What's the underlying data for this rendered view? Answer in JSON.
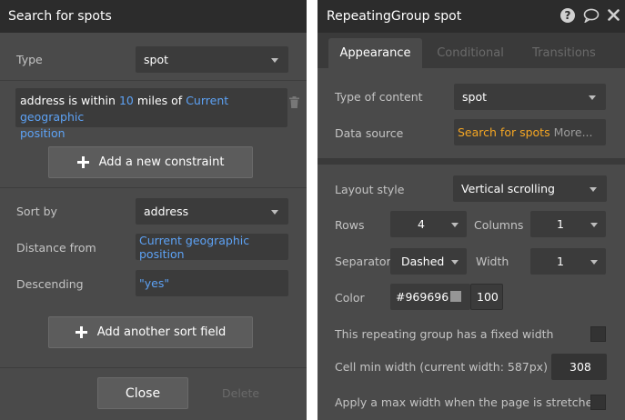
{
  "left_panel": {
    "title": "Search for spots",
    "type_label": "Type",
    "type_value": "spot",
    "constraint": {
      "prefix": "address is within",
      "number": "10",
      "middle": "miles",
      "of_label": "of",
      "location_line1": "Current geographic",
      "location_line2": "position"
    },
    "add_constraint_label": "Add a new constraint",
    "sort_by_label": "Sort by",
    "sort_by_value": "address",
    "distance_from_label": "Distance from",
    "distance_from_value": "Current geographic position",
    "descending_label": "Descending",
    "descending_value": "\"yes\"",
    "add_sort_label": "Add another sort field",
    "close_label": "Close",
    "delete_label": "Delete"
  },
  "right_panel": {
    "title": "RepeatingGroup spot",
    "tabs": [
      "Appearance",
      "Conditional",
      "Transitions"
    ],
    "active_tab": "Appearance",
    "type_of_content_label": "Type of content",
    "type_of_content_value": "spot",
    "data_source_label": "Data source",
    "data_source_value": "Search for spots",
    "data_source_more": "More...",
    "layout_style_label": "Layout style",
    "layout_style_value": "Vertical scrolling",
    "rows_label": "Rows",
    "rows_value": "4",
    "columns_label": "Columns",
    "columns_value": "1",
    "separator_label": "Separator",
    "separator_value": "Dashed",
    "width_label": "Width",
    "width_value": "1",
    "color_label": "Color",
    "color_value": "#969696",
    "color_swatch": "#969696",
    "opacity_value": "100",
    "fixed_width_label": "This repeating group has a fixed width",
    "cell_min_width_label": "Cell min width (current width: 587px)",
    "cell_min_width_value": "308",
    "max_width_label": "Apply a max width when the page is stretched"
  },
  "colors": {
    "panel_bg": "#4a4a4a",
    "titlebar_bg": "#2c2c2c",
    "field_bg": "#3b3b3b",
    "link_blue": "#5da2f5",
    "data_source_orange": "#f5a623"
  },
  "icons": [
    "trash-icon",
    "plus-icon",
    "help-icon",
    "comment-icon",
    "close-icon",
    "dropdown-caret-icon"
  ]
}
